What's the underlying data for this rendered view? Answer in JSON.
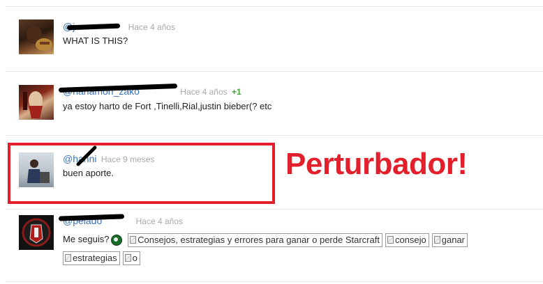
{
  "comments": [
    {
      "username": "@j",
      "time": "Hace 4 años",
      "text": "WHAT IS THIS?"
    },
    {
      "username": "@hanamori_zako",
      "time": "Hace 4 años",
      "votes": "+1",
      "text": "ya estoy harto de Fort ,Tinelli,Rial,justin bieber(? etc"
    },
    {
      "username": "@hanni",
      "time": "Hace 9 meses",
      "text": "buen aporte."
    },
    {
      "username": "@pelado",
      "time": "Hace 4 años",
      "text": "Me seguis?",
      "images": [
        "Consejos, estrategias y errores para ganar o perde Starcraft",
        "consejo",
        "ganar",
        "estrategias",
        "o"
      ]
    }
  ],
  "annotation": {
    "text": "Perturbador!",
    "color": "#e21f2a"
  },
  "icons": {
    "emoji": "smiley-icon",
    "broken_image": "broken-image-icon"
  }
}
